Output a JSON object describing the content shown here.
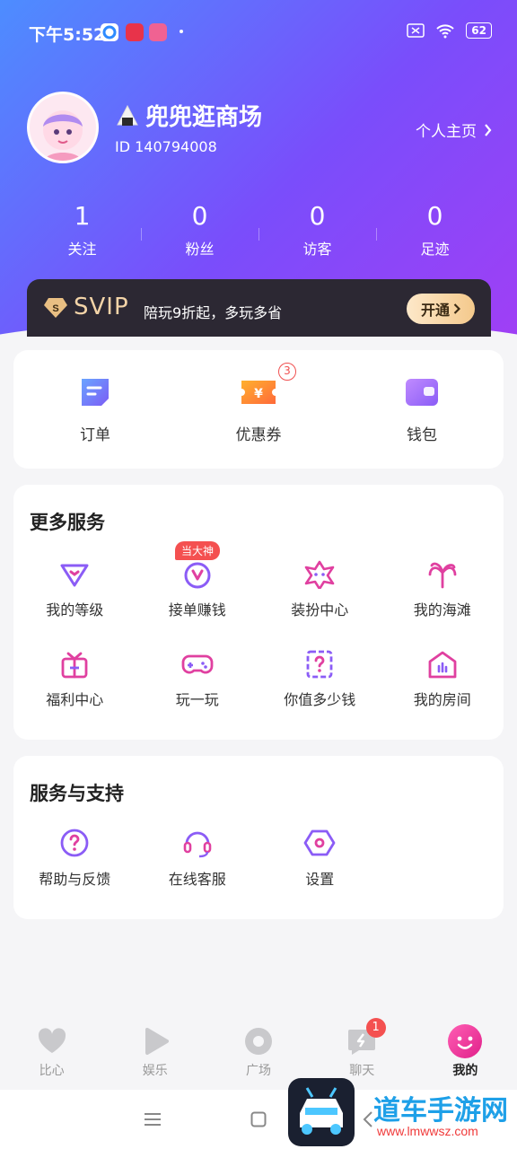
{
  "status_bar": {
    "time": "下午5:52",
    "battery": "62"
  },
  "profile": {
    "name": "兜兜逛商场",
    "id_text": "ID 140794008",
    "homepage_label": "个人主页"
  },
  "stats": [
    {
      "value": "1",
      "label": "关注"
    },
    {
      "value": "0",
      "label": "粉丝"
    },
    {
      "value": "0",
      "label": "访客"
    },
    {
      "value": "0",
      "label": "足迹"
    }
  ],
  "svip": {
    "title": "SVIP",
    "subtitle": "陪玩9折起，多玩多省",
    "button": "开通"
  },
  "quick": [
    {
      "label": "订单",
      "icon": "order-icon"
    },
    {
      "label": "优惠券",
      "icon": "coupon-icon",
      "badge": "3"
    },
    {
      "label": "钱包",
      "icon": "wallet-icon"
    }
  ],
  "more_services": {
    "title": "更多服务",
    "tag": "当大神",
    "items": [
      {
        "label": "我的等级",
        "icon": "level-icon"
      },
      {
        "label": "接单赚钱",
        "icon": "earn-icon"
      },
      {
        "label": "装扮中心",
        "icon": "dressup-icon"
      },
      {
        "label": "我的海滩",
        "icon": "beach-icon"
      },
      {
        "label": "福利中心",
        "icon": "gift-icon"
      },
      {
        "label": "玩一玩",
        "icon": "gamepad-icon"
      },
      {
        "label": "你值多少钱",
        "icon": "question-box-icon"
      },
      {
        "label": "我的房间",
        "icon": "room-icon"
      }
    ]
  },
  "support": {
    "title": "服务与支持",
    "items": [
      {
        "label": "帮助与反馈",
        "icon": "help-icon"
      },
      {
        "label": "在线客服",
        "icon": "headset-icon"
      },
      {
        "label": "设置",
        "icon": "settings-icon"
      }
    ]
  },
  "bottom_nav": [
    {
      "label": "比心",
      "icon": "heart-icon"
    },
    {
      "label": "娱乐",
      "icon": "play-icon"
    },
    {
      "label": "广场",
      "icon": "circle-icon"
    },
    {
      "label": "聊天",
      "icon": "chat-icon",
      "badge": "1"
    },
    {
      "label": "我的",
      "icon": "smile-icon",
      "active": true
    }
  ],
  "watermark": {
    "title": "道车手游网",
    "url": "www.lmwwsz.com"
  },
  "colors": {
    "accent": "#8b5cf6",
    "pink": "#e040a0",
    "badge": "#f45050"
  }
}
